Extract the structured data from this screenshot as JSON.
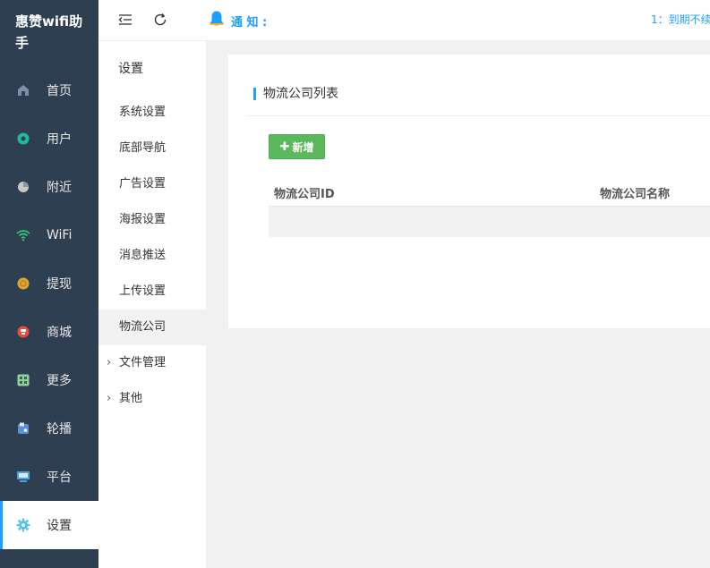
{
  "app": {
    "title": "惠赞wifi助手"
  },
  "sidebar": {
    "items": [
      {
        "label": "首页",
        "icon": "home-icon",
        "color": "#7a8fa8"
      },
      {
        "label": "用户",
        "icon": "user-icon",
        "color": "#1abc9c"
      },
      {
        "label": "附近",
        "icon": "nearby-icon",
        "color": "#c9c9c9"
      },
      {
        "label": "WiFi",
        "icon": "wifi-icon",
        "color": "#2ecc71"
      },
      {
        "label": "提现",
        "icon": "withdraw-icon",
        "color": "#e0a52e"
      },
      {
        "label": "商城",
        "icon": "shop-icon",
        "color": "#e74c3c"
      },
      {
        "label": "更多",
        "icon": "more-icon",
        "color": "#8fd19e"
      },
      {
        "label": "轮播",
        "icon": "carousel-icon",
        "color": "#5b8fd6"
      },
      {
        "label": "平台",
        "icon": "platform-icon",
        "color": "#4aa3df"
      },
      {
        "label": "设置",
        "icon": "settings-icon",
        "color": "#4fc3e8",
        "active": true
      }
    ]
  },
  "header": {
    "notice_label": "通 知 :",
    "marquee": "1：到期不续"
  },
  "subnav": {
    "title": "设置",
    "items": [
      {
        "label": "系统设置"
      },
      {
        "label": "底部导航"
      },
      {
        "label": "广告设置"
      },
      {
        "label": "海报设置"
      },
      {
        "label": "消息推送"
      },
      {
        "label": "上传设置"
      },
      {
        "label": "物流公司",
        "active": true
      },
      {
        "label": "文件管理",
        "expandable": true
      },
      {
        "label": "其他",
        "expandable": true
      }
    ]
  },
  "main": {
    "card_title": "物流公司列表",
    "add_button": "新增",
    "columns": [
      "物流公司ID",
      "物流公司名称"
    ]
  },
  "colors": {
    "accent": "#1e9fff",
    "sidebar_bg": "#2f3f52",
    "success": "#5cb85c"
  }
}
